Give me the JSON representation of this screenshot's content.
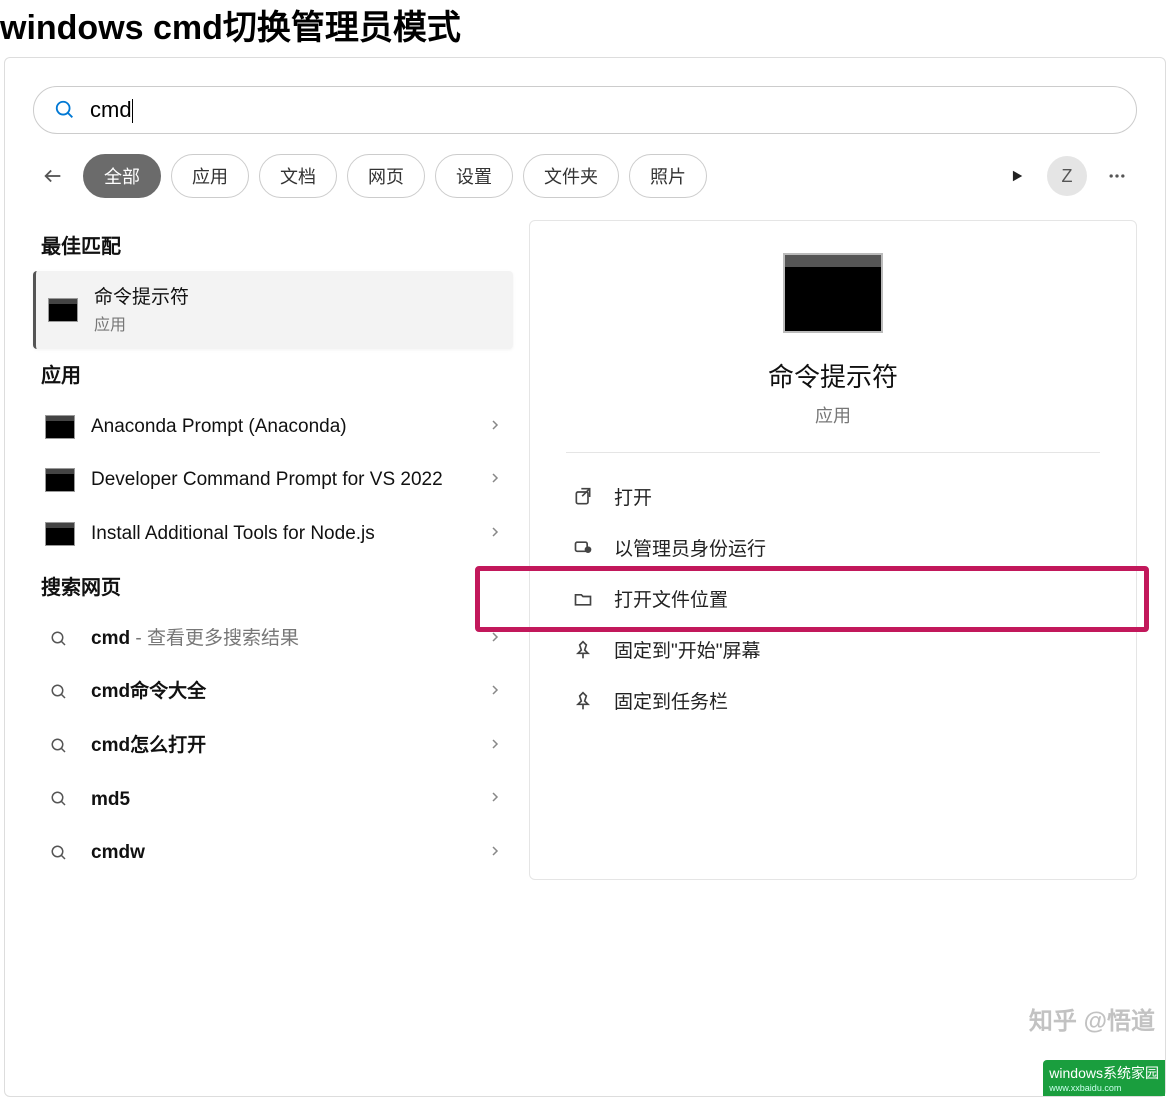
{
  "page": {
    "title": "windows cmd切换管理员模式"
  },
  "search": {
    "value": "cmd"
  },
  "filters": {
    "items": [
      "全部",
      "应用",
      "文档",
      "网页",
      "设置",
      "文件夹",
      "照片"
    ],
    "active_index": 0
  },
  "header": {
    "avatar_letter": "Z"
  },
  "left": {
    "best_match_label": "最佳匹配",
    "best_match": {
      "title": "命令提示符",
      "subtitle": "应用"
    },
    "apps_label": "应用",
    "apps": [
      {
        "title": "Anaconda Prompt (Anaconda)"
      },
      {
        "title": "Developer Command Prompt for VS 2022"
      },
      {
        "title": "Install Additional Tools for Node.js"
      }
    ],
    "web_label": "搜索网页",
    "web": [
      {
        "prefix": "cmd",
        "suffix": " - 查看更多搜索结果"
      },
      {
        "prefix": "cmd命令大全",
        "suffix": ""
      },
      {
        "prefix": "cmd怎么打开",
        "suffix": ""
      },
      {
        "prefix": "md5",
        "suffix": ""
      },
      {
        "prefix": "cmdw",
        "suffix": ""
      }
    ]
  },
  "detail": {
    "title": "命令提示符",
    "subtitle": "应用",
    "actions": [
      {
        "icon": "open",
        "label": "打开"
      },
      {
        "icon": "admin",
        "label": "以管理员身份运行",
        "highlighted": true
      },
      {
        "icon": "folder",
        "label": "打开文件位置"
      },
      {
        "icon": "pin",
        "label": "固定到\"开始\"屏幕"
      },
      {
        "icon": "pin",
        "label": "固定到任务栏"
      }
    ]
  },
  "watermark": {
    "text1": "知乎 @悟道",
    "text2": "windows系统家园",
    "text2b": "www.xxbaidu.com"
  }
}
